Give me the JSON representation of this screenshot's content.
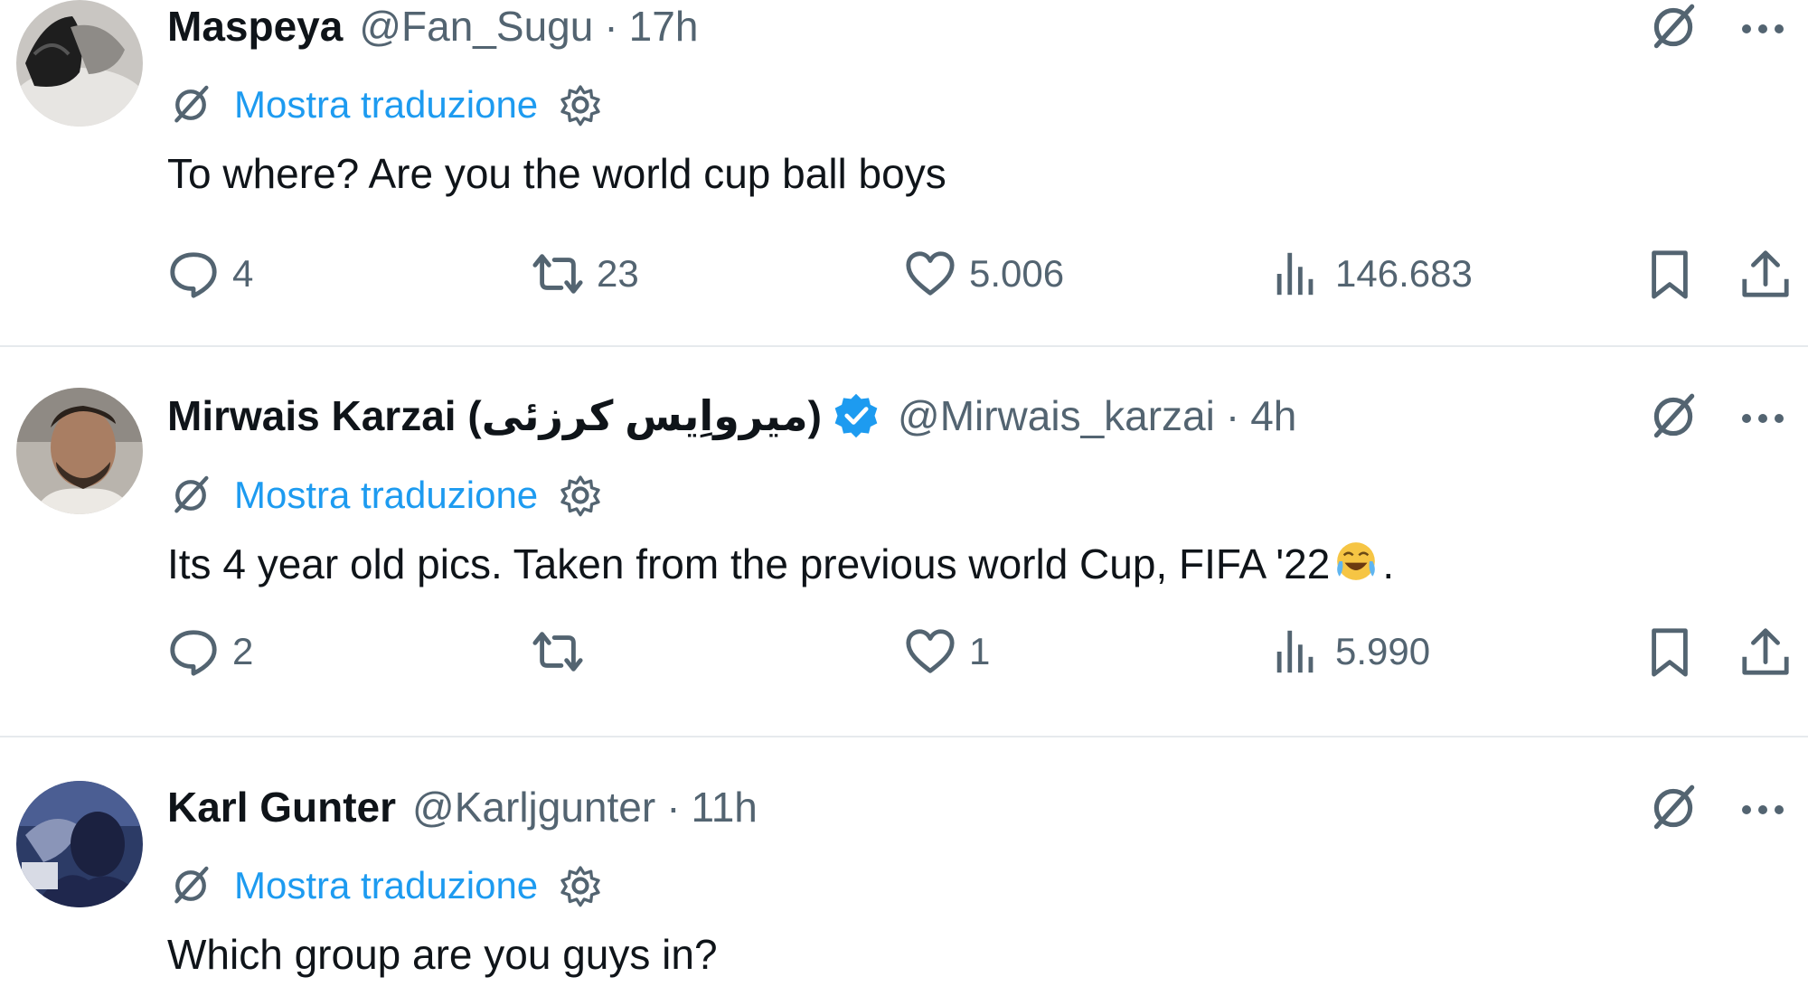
{
  "translate_label": "Mostra traduzione",
  "tweets": [
    {
      "name": "Maspeya",
      "handle": "@Fan_Sugu",
      "separator": "·",
      "time": "17h",
      "verified": false,
      "text": "To where? Are you the world cup ball boys",
      "replies": "4",
      "retweets": "23",
      "likes": "5.006",
      "views": "146.683",
      "avatar_icon": "avatar-maspeya"
    },
    {
      "name": "Mirwais Karzai (میرواِیس کرزئی)",
      "handle": "@Mirwais_karzai",
      "separator": "·",
      "time": "4h",
      "verified": true,
      "text_before_emoji": "Its 4 year old pics. Taken from the previous world Cup, FIFA '22",
      "text_after_emoji": ".",
      "emoji_icon": "tears-of-joy-emoji",
      "replies": "2",
      "retweets": "",
      "likes": "1",
      "views": "5.990",
      "avatar_icon": "avatar-mirwais"
    },
    {
      "name": "Karl Gunter",
      "handle": "@Karljgunter",
      "separator": "·",
      "time": "11h",
      "verified": false,
      "text": "Which group are you guys in?",
      "avatar_icon": "avatar-karl"
    }
  ],
  "colors": {
    "link_blue": "#1d9bf0",
    "secondary_gray": "#536471",
    "primary_text": "#0f1419",
    "divider": "#e6eaed",
    "verified_blue": "#1d9bf0"
  },
  "icons": {
    "grok": "grok-icon",
    "more": "more-dots-icon",
    "translate_grok": "grok-icon",
    "settings": "settings-gear-icon",
    "reply": "reply-bubble-icon",
    "retweet": "retweet-icon",
    "like": "heart-icon",
    "views": "views-bar-icon",
    "bookmark": "bookmark-icon",
    "share": "share-icon",
    "verified": "verified-badge-icon"
  }
}
